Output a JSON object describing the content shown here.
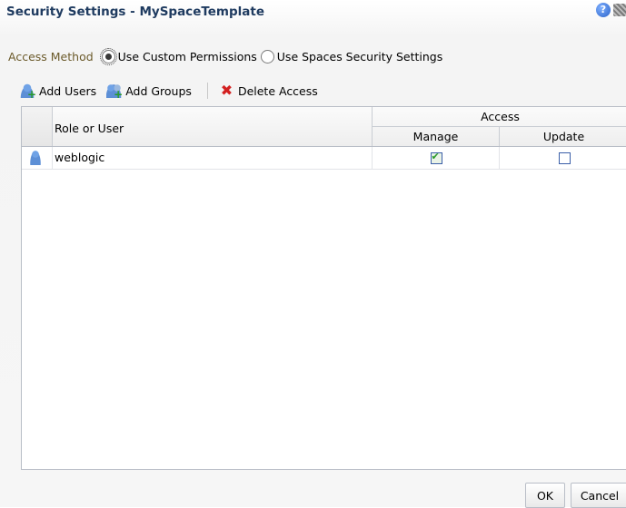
{
  "dialog": {
    "title": "Security Settings - MySpaceTemplate",
    "help_symbol": "?"
  },
  "access_method": {
    "label": "Access Method",
    "options": [
      {
        "label": "Use Custom Permissions",
        "selected": true
      },
      {
        "label": "Use Spaces Security Settings",
        "selected": false
      }
    ]
  },
  "toolbar": {
    "add_users": "Add Users",
    "add_groups": "Add Groups",
    "delete_access": "Delete Access"
  },
  "table": {
    "col_role": "Role or User",
    "col_access_group": "Access",
    "col_manage": "Manage",
    "col_update": "Update",
    "rows": [
      {
        "name": "weblogic",
        "manage": true,
        "update": false
      }
    ]
  },
  "footer": {
    "ok": "OK",
    "cancel": "Cancel"
  },
  "icons": {
    "help": "help-icon",
    "close": "close-icon",
    "add_users": "add-user-icon",
    "add_groups": "add-group-icon",
    "delete": "delete-icon",
    "user": "user-icon"
  }
}
